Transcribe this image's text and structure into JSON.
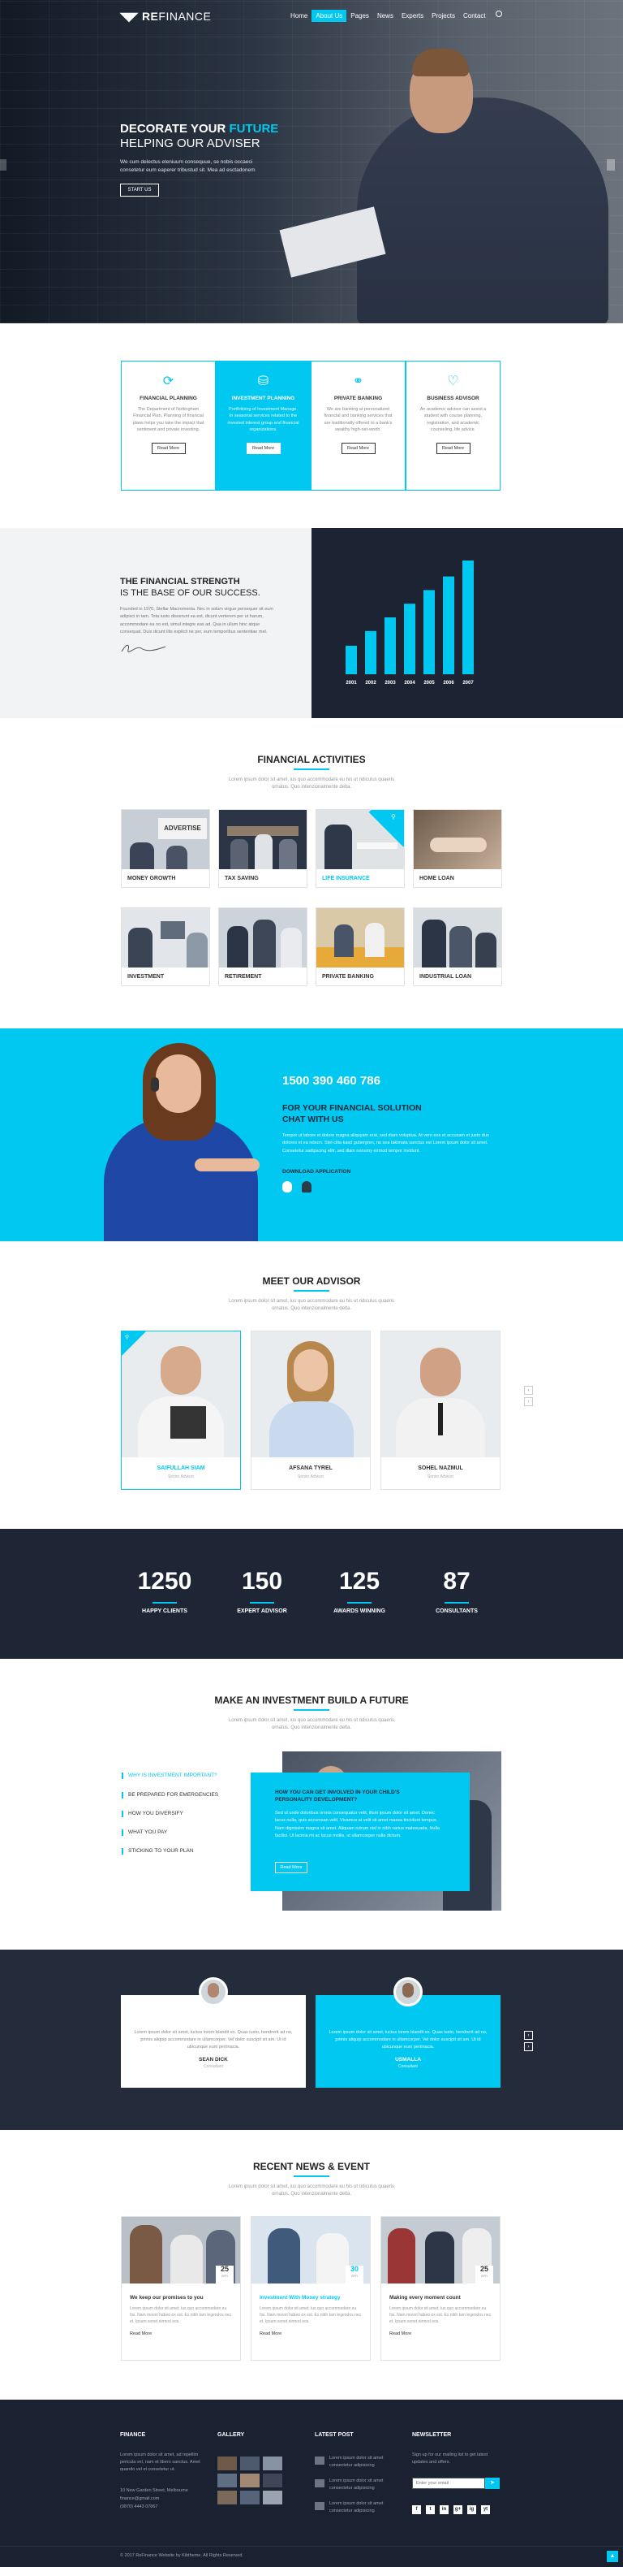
{
  "header": {
    "logo_prefix": "RE",
    "logo_suffix": "FINANCE",
    "nav": [
      "Home",
      "About Us",
      "Pages",
      "News",
      "Experts",
      "Projects",
      "Contact"
    ],
    "active_nav": "About Us"
  },
  "hero": {
    "title_white": "DECORATE YOUR ",
    "title_cyan": "FUTURE",
    "subtitle": "HELPING OUR ADVISER",
    "text": "We cum delectus eleniuum consequue, se nobis occaeci consetetur eum eaperer tribustud sit. Mea ad esctadonem",
    "button": "START US"
  },
  "services": [
    {
      "title": "FINANCIAL PLANNING",
      "text": "The Department of Nottingham Financial Plan, Planning of financial plans helps you take the impact that sentiment and private investing.",
      "button": "Read More",
      "icon": "refresh-icon"
    },
    {
      "title": "INVESTMENT PLANNING",
      "text": "Portfolioing of Investment Manage. In seasonal services related to the invested interest group and financial organizations.",
      "button": "Read More",
      "icon": "piggy-bank-icon"
    },
    {
      "title": "PRIVATE BANKING",
      "text": "We are banking at personalized financial and banking services that are traditionally offered to a bank's wealthy high-net-worth.",
      "button": "Read More",
      "icon": "handshake-icon"
    },
    {
      "title": "BUSINESS ADVISOR",
      "text": "An academic advisor can assist a student with course planning, registration, and academic counseling, life advice.",
      "button": "Read More",
      "icon": "heart-icon"
    }
  ],
  "strength": {
    "title1": "THE FINANCIAL STRENGTH",
    "title2": "IS THE BASE OF OUR SUCCESS.",
    "text": "Founded in 1970, Stellar Macromenta. Nec in solum virgue persequer sit eum adipisci in tam. Tota iusto disserunt ea est, dicunt verterem per ut harum, accommodare ea no est, simul integre eas ad. Qua in ullum hinc atque consequat. Duis dicunt illis explicit ne per, eum temporibus sententiae mel.",
    "signature": "Signature",
    "years": [
      "2001",
      "2002",
      "2003",
      "2004",
      "2005",
      "2006",
      "2007"
    ],
    "bar_levels": [
      0.25,
      0.38,
      0.5,
      0.62,
      0.74,
      0.86,
      1.0
    ]
  },
  "activities": {
    "title": "FINANCIAL ACTIVITIES",
    "subtitle": "Lorem ipsum dolor sit amet, ius quo accommodare eu his ut ridiculus quaeris ornatus. Quo intenzionalmente delta.",
    "items": [
      "MONEY GROWTH",
      "TAX SAVING",
      "LIFE INSURANCE",
      "HOME LOAN",
      "INVESTMENT",
      "RETIREMENT",
      "PRIVATE BANKING",
      "INDUSTRIAL LOAN"
    ],
    "highlighted": "LIFE INSURANCE",
    "advertise_label": "ADVERTISE"
  },
  "chat": {
    "phone": "1500 390 460 786",
    "title1": "FOR YOUR FINANCIAL SOLUTION",
    "title2": "CHAT WITH US",
    "text": "Tempor ut labore et dolore magna aliquyam erat, sed diam voluptua. At vero eos et accusam et justo duo dolores et ea rebum. Stet clita kasd gubergren, no sea takimata sanctus est Lorem ipsum dolor sit amet. Consetetur sadipscing elitr, sed diam nonumy eirmod tempor invidunt.",
    "download": "DOWNLOAD APPLICATION"
  },
  "advisors": {
    "title": "MEET OUR ADVISOR",
    "subtitle": "Lorem ipsum dolor sit amet, ius quo accommodare eu his ut ridiculus quaeris ornatus. Quo intenzionalmente delta.",
    "people": [
      {
        "name": "SAIFULLAH SIAM",
        "role": "Senior Advisor"
      },
      {
        "name": "AFSANA TYREL",
        "role": "Senior Advisor"
      },
      {
        "name": "SOHEL NAZMUL",
        "role": "Senior Advisor"
      }
    ]
  },
  "counters": [
    {
      "value": "1250",
      "label": "HAPPY CLIENTS"
    },
    {
      "value": "150",
      "label": "EXPERT ADVISOR"
    },
    {
      "value": "125",
      "label": "AWARDS WINNING"
    },
    {
      "value": "87",
      "label": "CONSULTANTS"
    }
  ],
  "invest": {
    "title": "MAKE AN INVESTMENT BUILD A FUTURE",
    "subtitle": "Lorem ipsum dolor sit amet, ius quo accommodare eu his ut ridiculus quaeris ornatus. Quo intenzionalmente delta.",
    "list": [
      "WHY IS INVESTMENT IMPORTANT?",
      "BE PREPARED FOR EMERGENCIES",
      "HOW YOU DIVERSIFY",
      "WHAT YOU PAY",
      "STICKING TO YOUR PLAN"
    ],
    "active": "WHY IS INVESTMENT IMPORTANT?",
    "box_title": "HOW YOU CAN GET INVOLVED IN YOUR CHILD'S PERSONALITY DEVELOPMENT?",
    "box_text": "Sed ut unde doloribus omnis consequatur velit, illum ipsum dolor sit amet. Donec lacus nulla, quis accumsan velit. Vivamus at velit sit amet massa tincidunt tempus. Nam dignissim magna sit amet. Aliquam rutrum nisl in nibh varius malesuada. Nulla facilisi. Ut lacinia mi ac lacus mollis, ut ullamcorper nulla dictum.",
    "box_button": "Read More"
  },
  "testimonials": [
    {
      "name": "SEAN DICK",
      "role": "Consultant",
      "text": "Lorem ipsum dolor sit amet, luctus lorem blandit ex. Quas iusto, hendrerit ad no, primis aliquip accommodare in ullamcorper. Vel dolor suscipit sit am. Ut id ubicunque eum pertinacia."
    },
    {
      "name": "USMALLA",
      "role": "Consultant",
      "text": "Lorem ipsum dolor sit amet, luctus lorem blandit ex. Quas iusto, hendrerit ad no, primis aliquip accommodare in ullamcorper. Vel dolor suscipit sit am. Ut id ubicunque eum pertinacia."
    }
  ],
  "news": {
    "title": "RECENT NEWS & EVENT",
    "subtitle": "Lorem ipsum dolor sit amet, ius quo accommodare eu his ut ridiculus quaeris ornatus. Quo intenzionalmente delta.",
    "posts": [
      {
        "day": "25",
        "month": "APR",
        "title": "We keep our promises to you",
        "text": "Lorem ipsum dolor sit amet, ius quo accommodare eu his. Nam movet habeo ex est. Ex nibh tam legendos nec et. Ipsum sonet eirmod eos.",
        "more": "Read More"
      },
      {
        "day": "30",
        "month": "APR",
        "title": "Investment With Money strategy",
        "text": "Lorem ipsum dolor sit amet, ius quo accommodare eu his. Nam movet habeo ex est. Ex nibh tam legendos nec et. Ipsum sonet eirmod eos.",
        "more": "Read More"
      },
      {
        "day": "25",
        "month": "APR",
        "title": "Making every moment count",
        "text": "Lorem ipsum dolor sit amet, ius quo accommodare eu his. Nam movet habeo ex est. Ex nibh tam legendos nec et. Ipsum sonet eirmod eos.",
        "more": "Read More"
      }
    ]
  },
  "footer": {
    "finance_title": "FINANCE",
    "finance_text": "Lorem ipsum dolor sit amet, ad repellim pericula vel, nam et libero sanctus. Amet quando vel et consetetur ut.",
    "address": "10 New Garden Street, Melbourne",
    "email": "finance@gmail.com",
    "phone": "(0870) 4443 07867",
    "gallery_title": "GALLERY",
    "latest_title": "LATEST POST",
    "latest": [
      "Lorem ipsum dolor sit amet consectetur adipisicing",
      "Lorem ipsum dolor sit amet consectetur adipisicing",
      "Lorem ipsum dolor sit amet consectetur adipisicing"
    ],
    "newsletter_title": "NEWSLETTER",
    "newsletter_text": "Sign up for our mailing list to get latest updates and offers.",
    "email_placeholder": "Enter your email",
    "social": [
      "f",
      "t",
      "in",
      "g+",
      "ig",
      "yt"
    ],
    "copyright": "© 2017 ReFinance Website by Kibtheme. All Rights Reserved."
  }
}
